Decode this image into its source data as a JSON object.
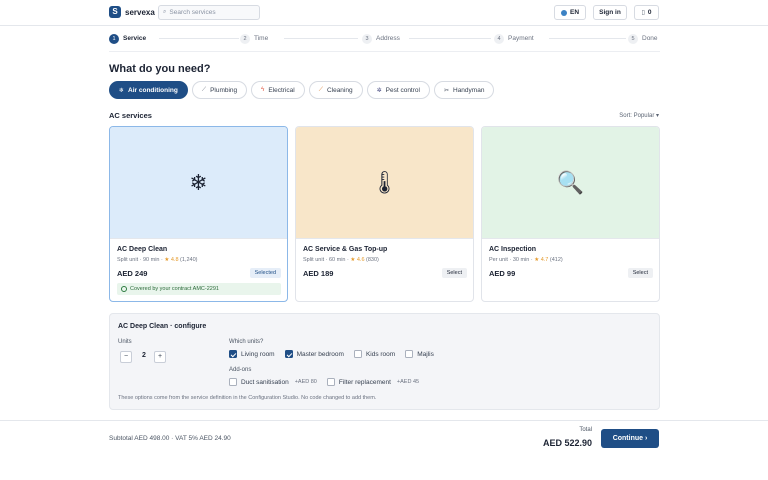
{
  "header": {
    "logo_letter": "S",
    "brand": "servexa",
    "search_placeholder": "Search services",
    "language": "EN",
    "signin_label": "Sign in",
    "cart_count": "0"
  },
  "steps": [
    {
      "num": "1",
      "label": "Service"
    },
    {
      "num": "2",
      "label": "Time"
    },
    {
      "num": "3",
      "label": "Address"
    },
    {
      "num": "4",
      "label": "Payment"
    },
    {
      "num": "5",
      "label": "Done"
    }
  ],
  "page_title": "What do you need?",
  "categories": [
    {
      "icon": "❄",
      "label": "Air conditioning"
    },
    {
      "icon": "⟋",
      "label": "Plumbing"
    },
    {
      "icon": "ϟ",
      "label": "Electrical"
    },
    {
      "icon": "⟋",
      "label": "Cleaning"
    },
    {
      "icon": "✲",
      "label": "Pest control"
    },
    {
      "icon": "✂",
      "label": "Handyman"
    }
  ],
  "section_title": "AC services",
  "sort_label": "Sort: Popular ▾",
  "cards": [
    {
      "icon": "❄",
      "title": "AC Deep Clean",
      "meta": "Split unit · 90 min · ",
      "star": "★",
      "rating": "4.8",
      "reviews": " (1,240)",
      "price": "AED 249",
      "badge": "Selected",
      "contract_note": "Covered by your contract AMC-2291",
      "bg": "#dcebfa"
    },
    {
      "icon": "🌡",
      "title": "AC Service & Gas Top-up",
      "meta": "Split unit · 60 min · ",
      "star": "★",
      "rating": "4.6",
      "reviews": " (830)",
      "price": "AED 189",
      "badge": "Select",
      "bg": "#f8e6c9"
    },
    {
      "icon": "🔍",
      "title": "AC Inspection",
      "meta": "Per unit · 30 min · ",
      "star": "★",
      "rating": "4.7",
      "reviews": " (412)",
      "price": "AED 99",
      "badge": "Select",
      "bg": "#e2f3e6"
    }
  ],
  "configure": {
    "title": "AC Deep Clean · configure",
    "units_label": "Units",
    "minus": "−",
    "plus": "+",
    "quantity": "2",
    "which_units_label": "Which units?",
    "units": [
      {
        "label": "Living room",
        "checked": true
      },
      {
        "label": "Master bedroom",
        "checked": true
      },
      {
        "label": "Kids room",
        "checked": false
      },
      {
        "label": "Majlis",
        "checked": false
      }
    ],
    "addons_label": "Add-ons",
    "addons": [
      {
        "label": "Duct sanitisation",
        "price": "+AED 80",
        "checked": false
      },
      {
        "label": "Filter replacement",
        "price": "+AED 45",
        "checked": false
      }
    ],
    "note": "These options come from the service definition in the Configuration Studio. No code changed to add them."
  },
  "footer": {
    "subtotal": "Subtotal AED 498.00 · VAT 5% AED 24.90",
    "total_label": "Total",
    "total_value": "AED 522.90",
    "continue_label": "Continue ›"
  }
}
